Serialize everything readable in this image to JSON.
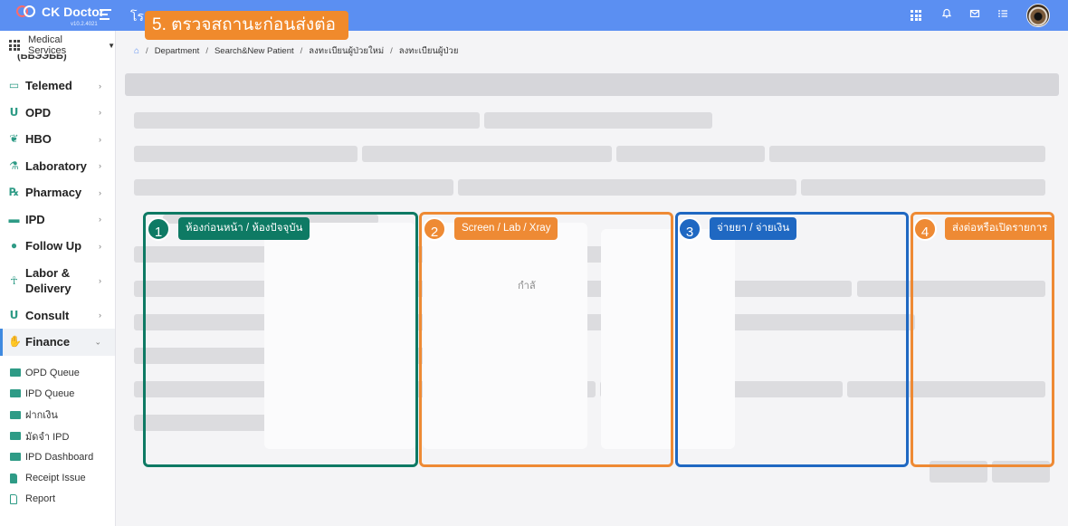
{
  "topbar": {
    "app_name": "CK Doctor",
    "version": "v10.2.4021",
    "hospital_name": "โรง"
  },
  "banner": {
    "text": "5. ตรวจสถานะก่อนส่งต่อ"
  },
  "sidebar": {
    "service_selector": "Medical Services",
    "items": [
      {
        "label": "Telemed",
        "icon": "video-icon"
      },
      {
        "label": "OPD",
        "icon": "stethoscope-icon"
      },
      {
        "label": "HBO",
        "icon": "leaf-icon"
      },
      {
        "label": "Laboratory",
        "icon": "microscope-icon"
      },
      {
        "label": "Pharmacy",
        "icon": "rx-icon"
      },
      {
        "label": "IPD",
        "icon": "bed-icon"
      },
      {
        "label": "Follow Up",
        "icon": "user-check-icon"
      },
      {
        "label": "Labor & Delivery",
        "icon": "baby-icon"
      },
      {
        "label": "Consult",
        "icon": "stethoscope-icon"
      },
      {
        "label": "Finance",
        "icon": "hand-money-icon"
      }
    ],
    "finance_sub": [
      {
        "label": "OPD Queue",
        "icon": "money-icon"
      },
      {
        "label": "IPD Queue",
        "icon": "money-icon"
      },
      {
        "label": "ฝากเงิน",
        "icon": "money-icon"
      },
      {
        "label": "มัดจำ IPD",
        "icon": "money-icon"
      },
      {
        "label": "IPD Dashboard",
        "icon": "money-icon"
      },
      {
        "label": "Receipt Issue",
        "icon": "document-icon"
      },
      {
        "label": "Report",
        "icon": "document-outline-icon"
      }
    ]
  },
  "breadcrumb": [
    "Department",
    "Search&New Patient",
    "ลงทะเบียนผู้ป่วยใหม่",
    "ลงทะเบียนผู้ป่วย"
  ],
  "loading_text": "กำลั",
  "annotations": [
    {
      "number": "1",
      "label": "ห้องก่อนหน้า / ห้องปัจจุบัน",
      "color": "#0e7a64"
    },
    {
      "number": "2",
      "label": "Screen / Lab / Xray",
      "color": "#ee8a34"
    },
    {
      "number": "3",
      "label": "จ่ายยา / จ่ายเงิน",
      "color": "#1f68c2"
    },
    {
      "number": "4",
      "label": "ส่งต่อหรือเปิดรายการ",
      "color": "#ee8a34"
    }
  ],
  "colors": {
    "topbar": "#5b8ff2",
    "accent_green": "#2e9b86",
    "banner": "#f08a2c"
  }
}
